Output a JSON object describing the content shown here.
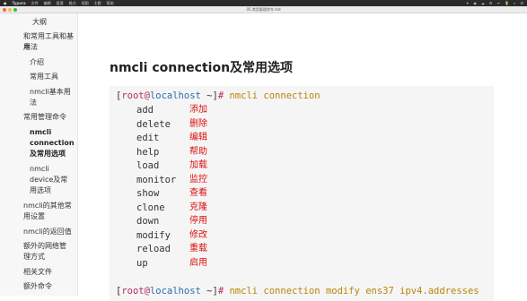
{
  "menubar": {
    "app": "Typora",
    "menus": [
      "文件",
      "编辑",
      "段落",
      "格式",
      "视图",
      "主题",
      "帮助"
    ],
    "status": [
      "✦",
      "◉",
      "☁",
      "⚙",
      "ᯤ",
      "🔋",
      "⌕",
      "☰"
    ]
  },
  "window": {
    "title": "05.常用管理命令.md",
    "traffic_colors": [
      "#ff5f57",
      "#febc2e",
      "#28c840"
    ]
  },
  "sidebar": {
    "items": [
      {
        "label": "大纲"
      },
      {
        "label": "和常用工具和基本"
      },
      {
        "label": "用法"
      },
      {
        "label": "介绍"
      },
      {
        "label": "常用工具"
      },
      {
        "label": "nmcli基本用"
      },
      {
        "label": "法"
      },
      {
        "label": "常用管理命令"
      },
      {
        "label": "nmcli"
      },
      {
        "label": "connection"
      },
      {
        "label": "及常用选项"
      },
      {
        "label": "nmcli"
      },
      {
        "label": "device及常"
      },
      {
        "label": "用选项"
      },
      {
        "label": "nmcli的其他常"
      },
      {
        "label": "用设置"
      },
      {
        "label": "nmcli的返回值"
      },
      {
        "label": "额外的网络管"
      },
      {
        "label": "理方式"
      },
      {
        "label": "相关文件"
      },
      {
        "label": "额外命令"
      }
    ]
  },
  "heading": "nmcli connection及常用选项",
  "code": {
    "prompt_open": "[",
    "user": "root",
    "at": "@",
    "host": "localhost",
    "prompt_tail": " ~]",
    "hash": "#",
    "command1": " nmcli connection",
    "command2": " nmcli connection modify ens37 ipv4.addresses",
    "rows": [
      {
        "cmd": "add",
        "desc": "添加"
      },
      {
        "cmd": "delete",
        "desc": "删除"
      },
      {
        "cmd": "edit",
        "desc": "编辑"
      },
      {
        "cmd": "help",
        "desc": "帮助"
      },
      {
        "cmd": "load",
        "desc": "加载"
      },
      {
        "cmd": "monitor",
        "desc": "监控"
      },
      {
        "cmd": "show",
        "desc": "查看"
      },
      {
        "cmd": "clone",
        "desc": "克隆"
      },
      {
        "cmd": "down",
        "desc": "停用"
      },
      {
        "cmd": "modify",
        "desc": "修改"
      },
      {
        "cmd": "reload",
        "desc": "重载"
      },
      {
        "cmd": "up",
        "desc": "启用"
      }
    ]
  }
}
